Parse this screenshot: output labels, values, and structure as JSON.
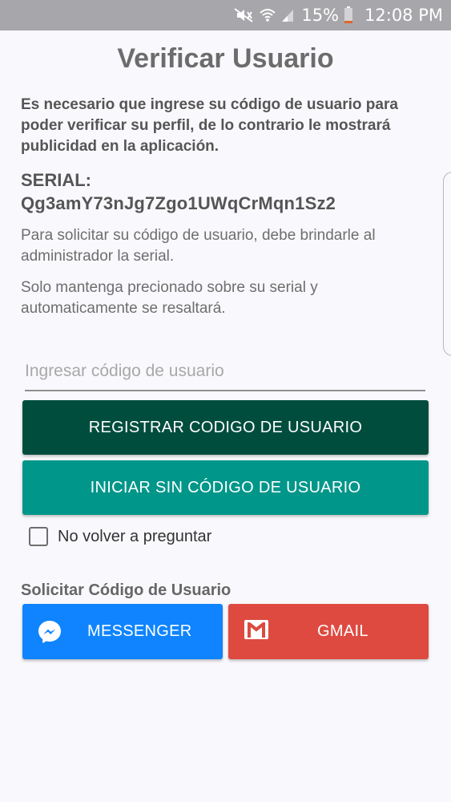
{
  "status_bar": {
    "battery": "15%",
    "time": "12:08 PM",
    "icons": [
      "mute-icon",
      "wifi-icon",
      "signal-icon",
      "battery-icon"
    ]
  },
  "page": {
    "title": "Verificar Usuario",
    "intro": "Es necesario que ingrese su código de usuario para poder verificar su perfil, de lo contrario le mostrará publicidad en la aplicación.",
    "serial_label": "SERIAL:",
    "serial_value": "Qg3amY73nJg7Zgo1UWqCrMqn1Sz2",
    "instruction_1": "Para solicitar su código de usuario, debe brindarle al administrador la serial.",
    "instruction_2": "Solo mantenga precionado sobre su serial y automaticamente se resaltará."
  },
  "form": {
    "code_input_placeholder": "Ingresar código de usuario",
    "code_input_value": "",
    "register_button": "REGISTRAR CODIGO DE USUARIO",
    "skip_button": "INICIAR SIN CÓDIGO DE USUARIO",
    "dont_ask_label": "No volver a preguntar",
    "dont_ask_checked": false
  },
  "request": {
    "section_title": "Solicitar Código de Usuario",
    "messenger_label": "MESSENGER",
    "gmail_label": "GMAIL"
  },
  "colors": {
    "register_button": "#004d3e",
    "skip_button": "#00968a",
    "messenger": "#0f84fe",
    "gmail": "#de4a40",
    "status_bar": "#a7a7ab"
  }
}
